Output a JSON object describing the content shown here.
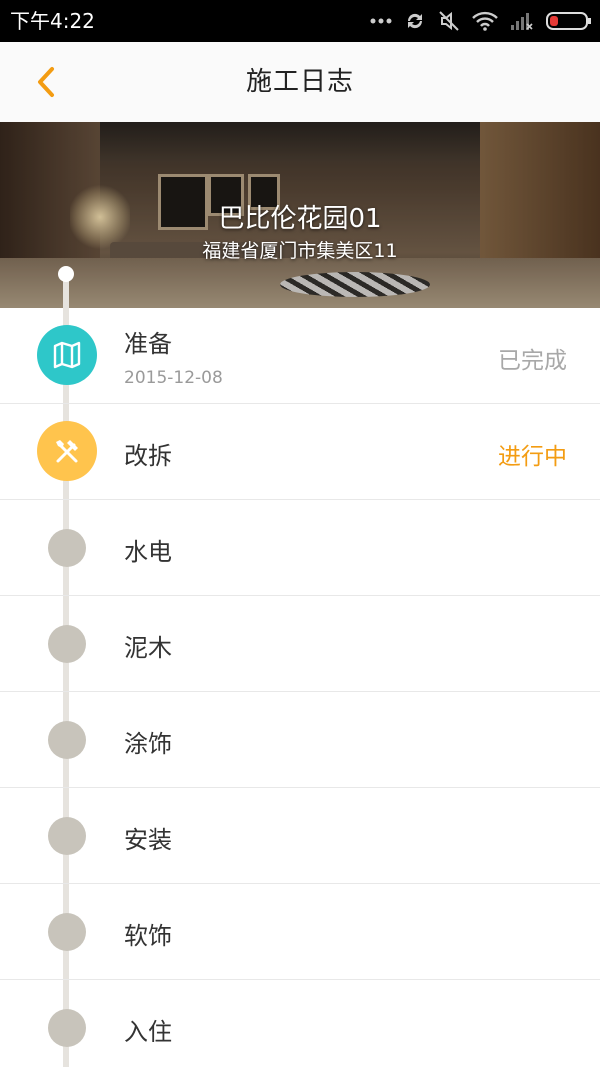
{
  "status_bar": {
    "time": "下午4:22"
  },
  "header": {
    "title": "施工日志"
  },
  "banner": {
    "project_name": "巴比伦花园01",
    "address": "福建省厦门市集美区11"
  },
  "colors": {
    "accent": "#f39c12",
    "completed_node": "#2ec7c9",
    "in_progress_node": "#ffc44d",
    "pending_node": "#c8c4bb",
    "completed_text": "#a8a8a8",
    "in_progress_text": "#f39c12"
  },
  "stages": [
    {
      "name": "准备",
      "date": "2015-12-08",
      "status": "已完成",
      "icon": "map-icon"
    },
    {
      "name": "改拆",
      "status": "进行中",
      "icon": "tools-icon"
    },
    {
      "name": "水电"
    },
    {
      "name": "泥木"
    },
    {
      "name": "涂饰"
    },
    {
      "name": "安装"
    },
    {
      "name": "软饰"
    },
    {
      "name": "入住"
    }
  ]
}
